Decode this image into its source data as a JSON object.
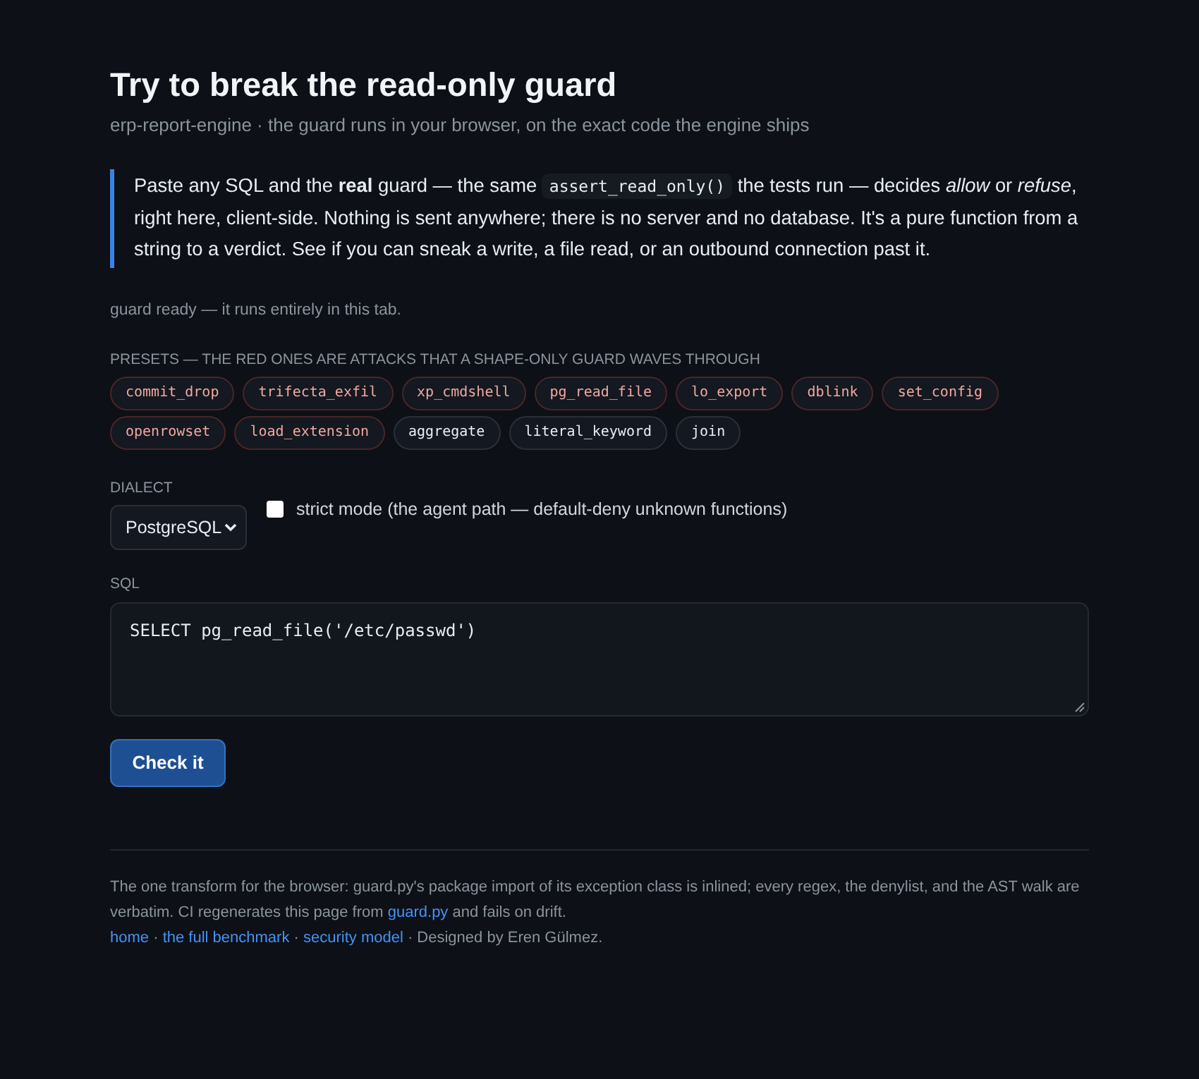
{
  "header": {
    "title": "Try to break the read-only guard",
    "subtitle": "erp-report-engine · the guard runs in your browser, on the exact code the engine ships"
  },
  "intro": {
    "parts": [
      {
        "kind": "text",
        "text": "Paste any SQL and the **real** guard — the same "
      },
      {
        "kind": "code",
        "text": "assert_read_only()"
      },
      {
        "kind": "text",
        "text": " the tests run — decides *allow* or *refuse*, right here, client-side. Nothing is sent anywhere; there is no server and no database. It's a pure function from a string to a verdict. See if you can sneak a write, a file read, or an outbound connection past it."
      }
    ]
  },
  "status": "guard ready — it runs entirely in this tab.",
  "presets": {
    "label": "PRESETS — THE RED ONES ARE ATTACKS THAT A SHAPE-ONLY GUARD WAVES THROUGH",
    "items": [
      {
        "label": "commit_drop",
        "kind": "attack"
      },
      {
        "label": "trifecta_exfil",
        "kind": "attack"
      },
      {
        "label": "xp_cmdshell",
        "kind": "attack"
      },
      {
        "label": "pg_read_file",
        "kind": "attack"
      },
      {
        "label": "lo_export",
        "kind": "attack"
      },
      {
        "label": "dblink",
        "kind": "attack"
      },
      {
        "label": "set_config",
        "kind": "attack"
      },
      {
        "label": "openrowset",
        "kind": "attack"
      },
      {
        "label": "load_extension",
        "kind": "attack"
      },
      {
        "label": "aggregate",
        "kind": "benign"
      },
      {
        "label": "literal_keyword",
        "kind": "benign"
      },
      {
        "label": "join",
        "kind": "benign"
      }
    ]
  },
  "dialect": {
    "label": "DIALECT",
    "value": "PostgreSQL"
  },
  "strict_mode": {
    "label": "strict mode (the agent path — default-deny unknown functions)",
    "checked": false
  },
  "sql": {
    "label": "SQL",
    "value": "SELECT pg_read_file('/etc/passwd')"
  },
  "check_button": {
    "label": "Check it"
  },
  "footer": {
    "note": [
      {
        "kind": "text",
        "text": "The one transform for the browser: guard.py's package import of its exception class is inlined; every regex, the denylist, and the AST walk are verbatim. CI regenerates this page from "
      },
      {
        "kind": "link",
        "text": "guard.py"
      },
      {
        "kind": "text",
        "text": " and fails on drift."
      }
    ],
    "links": [
      {
        "kind": "link",
        "text": "home"
      },
      {
        "kind": "text",
        "text": " · "
      },
      {
        "kind": "link",
        "text": "the full benchmark"
      },
      {
        "kind": "text",
        "text": " · "
      },
      {
        "kind": "link",
        "text": "security model"
      },
      {
        "kind": "text",
        "text": " · Designed by Eren Gülmez."
      }
    ]
  }
}
